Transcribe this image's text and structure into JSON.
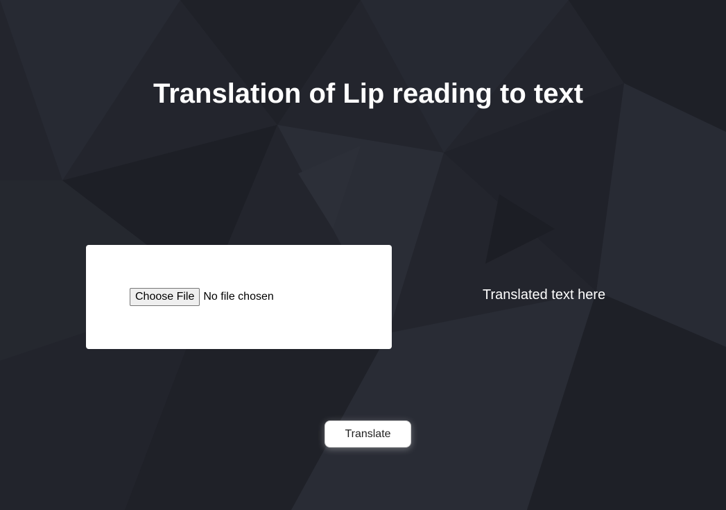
{
  "page": {
    "title": "Translation of Lip reading to text"
  },
  "upload": {
    "choose_file_label": "Choose File",
    "file_status": "No file chosen"
  },
  "output": {
    "placeholder_text": "Translated text here"
  },
  "actions": {
    "translate_label": "Translate"
  },
  "colors": {
    "background": "#23252d",
    "text": "#ffffff",
    "panel": "#ffffff"
  }
}
